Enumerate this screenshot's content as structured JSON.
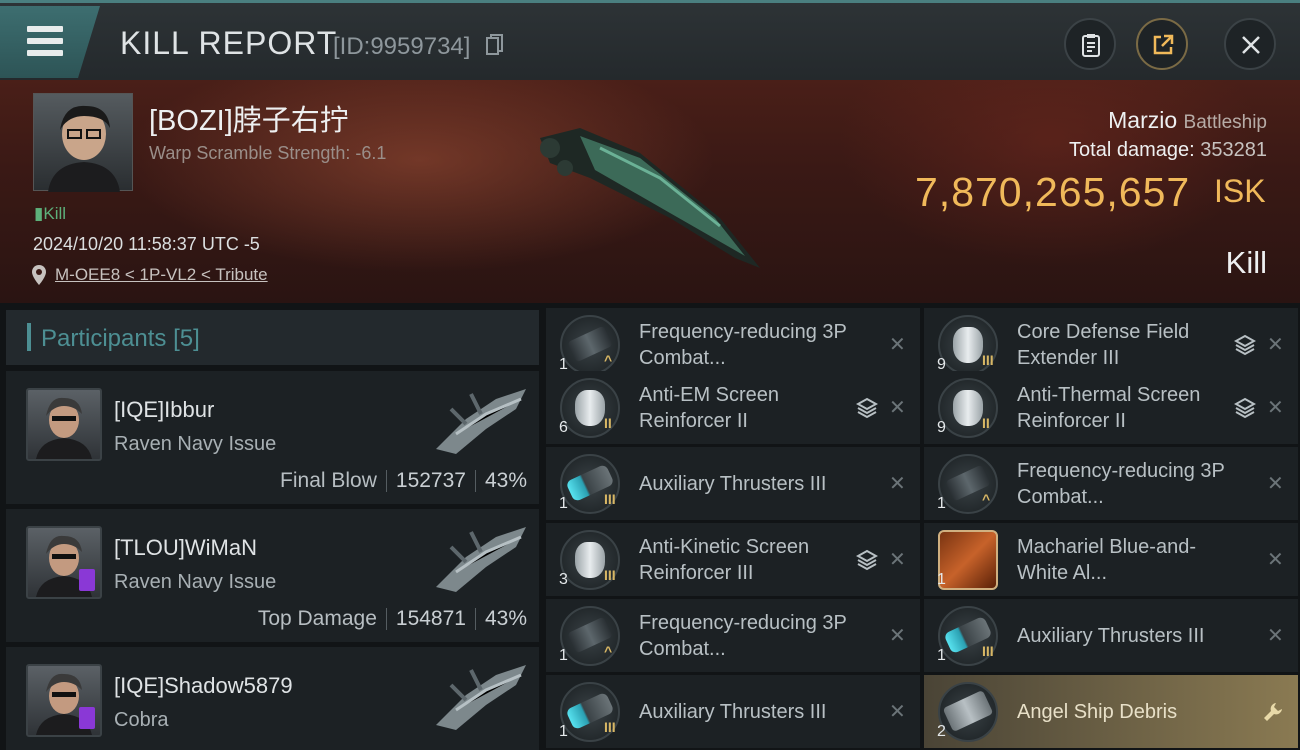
{
  "header": {
    "title": "KILL REPORT",
    "report_id": "[ID:9959734]"
  },
  "victim": {
    "name": "[BOZI]脖子右拧",
    "warp_scramble": "Warp Scramble Strength: -6.1",
    "kill_tag": "Kill",
    "datetime": "2024/10/20 11:58:37 UTC -5",
    "location": "M-OEE8 < 1P-VL2 < Tribute",
    "ship_name": "Marzio",
    "ship_class": "Battleship",
    "total_damage_label": "Total damage:",
    "total_damage_value": "353281",
    "isk_value": "7,870,265,657",
    "isk_unit": "ISK",
    "result": "Kill"
  },
  "participants": {
    "label": "Participants",
    "count": "[5]",
    "items": [
      {
        "name": "[IQE]Ibbur",
        "ship": "Raven Navy Issue",
        "role": "Final Blow",
        "damage": "152737",
        "percent": "43%",
        "badge": false
      },
      {
        "name": "[TLOU]WiMaN",
        "ship": "Raven Navy Issue",
        "role": "Top Damage",
        "damage": "154871",
        "percent": "43%",
        "badge": true
      },
      {
        "name": "[IQE]Shadow5879",
        "ship": "Cobra",
        "role": "",
        "damage": "",
        "percent": "",
        "badge": true
      }
    ]
  },
  "items": [
    {
      "name": "Frequency-reducing 3P Combat...",
      "qty": "1",
      "icon": "scram-icon",
      "meta": "^",
      "stack": false
    },
    {
      "name": "Core Defense Field Extender III",
      "qty": "9",
      "icon": "shield-icon",
      "meta": "III",
      "stack": true
    },
    {
      "name": "Anti-EM Screen Reinforcer II",
      "qty": "6",
      "icon": "shield-icon",
      "meta": "II",
      "stack": true
    },
    {
      "name": "Anti-Thermal Screen Reinforcer II",
      "qty": "9",
      "icon": "shield-icon",
      "meta": "II",
      "stack": true
    },
    {
      "name": "Auxiliary Thrusters III",
      "qty": "1",
      "icon": "thruster-icon",
      "meta": "III",
      "stack": false
    },
    {
      "name": "Frequency-reducing 3P Combat...",
      "qty": "1",
      "icon": "scram-icon",
      "meta": "^",
      "stack": false
    },
    {
      "name": "Anti-Kinetic Screen Reinforcer III",
      "qty": "3",
      "icon": "shield-icon",
      "meta": "III",
      "stack": true
    },
    {
      "name": "Machariel Blue-and-White Al...",
      "qty": "1",
      "icon": "blueprint-icon",
      "meta": "",
      "stack": false
    },
    {
      "name": "Frequency-reducing 3P Combat...",
      "qty": "1",
      "icon": "scram-icon",
      "meta": "^",
      "stack": false
    },
    {
      "name": "Auxiliary Thrusters III",
      "qty": "1",
      "icon": "thruster-icon",
      "meta": "III",
      "stack": false
    },
    {
      "name": "Auxiliary Thrusters III",
      "qty": "1",
      "icon": "thruster-icon",
      "meta": "III",
      "stack": false
    },
    {
      "name": "Angel Ship Debris",
      "qty": "2",
      "icon": "debris-icon",
      "meta": "",
      "stack": false,
      "highlight": true
    }
  ],
  "colors": {
    "accent": "#4d8f93",
    "isk": "#f0b95a",
    "kill_green": "#5db07a",
    "highlight": "#8a7a52"
  }
}
